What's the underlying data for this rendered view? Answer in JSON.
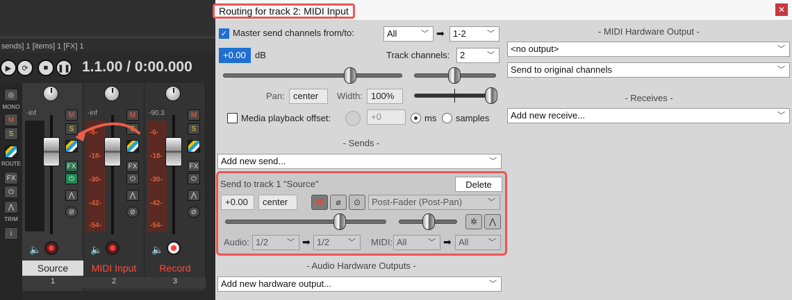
{
  "mixer": {
    "info_text": "sends] 1 [items] 1 [FX] 1",
    "time_display": "1.1.00 / 0:00.000",
    "left_labels": {
      "mono": "MONO",
      "route": "ROUTE",
      "trim": "TRIM"
    },
    "left_buttons": {
      "m": "M",
      "s": "S",
      "fx": "FX",
      "info": "i"
    },
    "tracks": [
      {
        "name": "Source",
        "number": "1",
        "peak": "-inf",
        "selected": true
      },
      {
        "name": "MIDI Input",
        "number": "2",
        "peak": "-inf",
        "selected": false
      },
      {
        "name": "Record",
        "number": "3",
        "peak": "-90.3",
        "selected": false
      }
    ],
    "meter_labels": [
      "-6-",
      "-18-",
      "-30-",
      "-42-",
      "-54-"
    ],
    "strip_buttons": {
      "m": "M",
      "s": "S",
      "fx": "FX"
    }
  },
  "window": {
    "title": "Routing for track 2: MIDI Input",
    "close_glyph": "✕",
    "master_send_label": "Master send channels from/to:",
    "master_from": "All",
    "master_to": "1-2",
    "volume_value": "+0.00",
    "volume_unit": "dB",
    "track_channels_label": "Track channels:",
    "track_channels_value": "2",
    "pan_label": "Pan:",
    "pan_value": "center",
    "width_label": "Width:",
    "width_value": "100%",
    "media_offset_label": "Media playback offset:",
    "media_offset_value": "+0",
    "unit_ms": "ms",
    "unit_samples": "samples",
    "sends_section": "- Sends -",
    "add_send": "Add new send...",
    "send": {
      "title": "Send to track 1 \"Source\"",
      "delete_label": "Delete",
      "volume": "+0.00",
      "pan": "center",
      "mute_label": "M",
      "phase_glyph": "ø",
      "mono_glyph": "⊙",
      "mode": "Post-Fader (Post-Pan)",
      "audio_label": "Audio:",
      "audio_from": "1/2",
      "audio_to": "1/2",
      "midi_label": "MIDI:",
      "midi_from": "All",
      "midi_to": "All"
    },
    "audio_hw_section": "- Audio Hardware Outputs -",
    "add_hw_output": "Add new hardware output...",
    "midi_hw_section": "- MIDI Hardware Output -",
    "midi_output": "<no output>",
    "midi_send_mode": "Send to original channels",
    "receives_section": "- Receives -",
    "add_receive": "Add new receive..."
  }
}
